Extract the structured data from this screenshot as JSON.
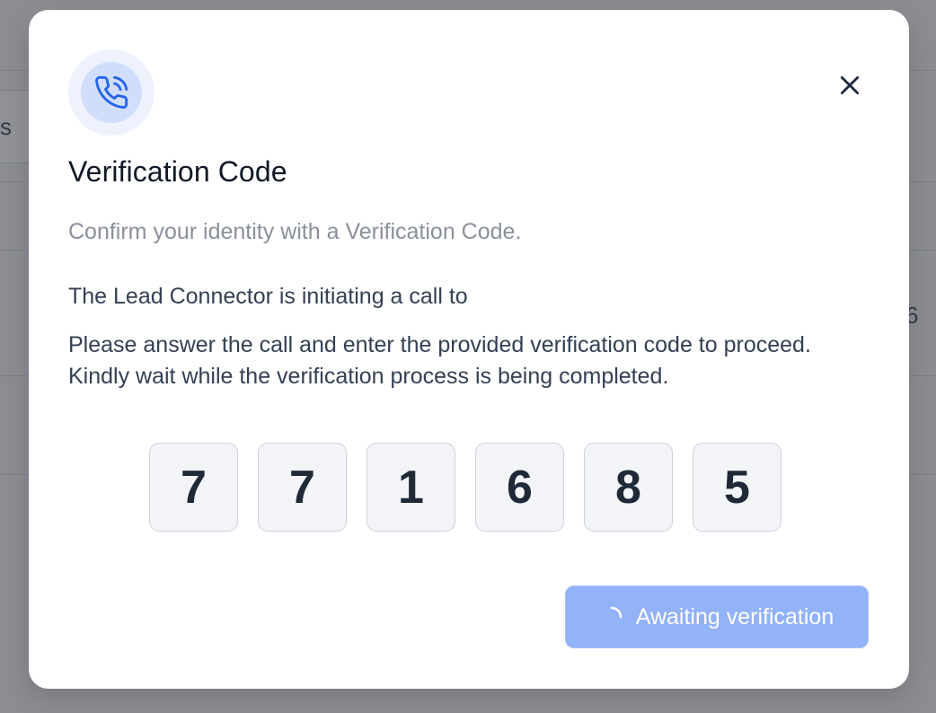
{
  "background": {
    "left_text": "s",
    "right_text": "6"
  },
  "modal": {
    "icon": "phone-call-icon",
    "close_icon": "close-icon",
    "title": "Verification Code",
    "subtitle": "Confirm your identity with a Verification Code.",
    "initiating_text": "The Lead Connector is initiating a call to",
    "instructions": "Please answer the call and enter the provided verification code to proceed. Kindly wait while the verification process is being completed.",
    "code_digits": [
      "7",
      "7",
      "1",
      "6",
      "8",
      "5"
    ],
    "button": {
      "label": "Awaiting verification",
      "icon": "spinner-icon"
    }
  },
  "colors": {
    "accent": "#2563eb",
    "button_bg": "#92b2f9",
    "icon_ring": "#eef2fd",
    "icon_inner": "#d0defb"
  }
}
